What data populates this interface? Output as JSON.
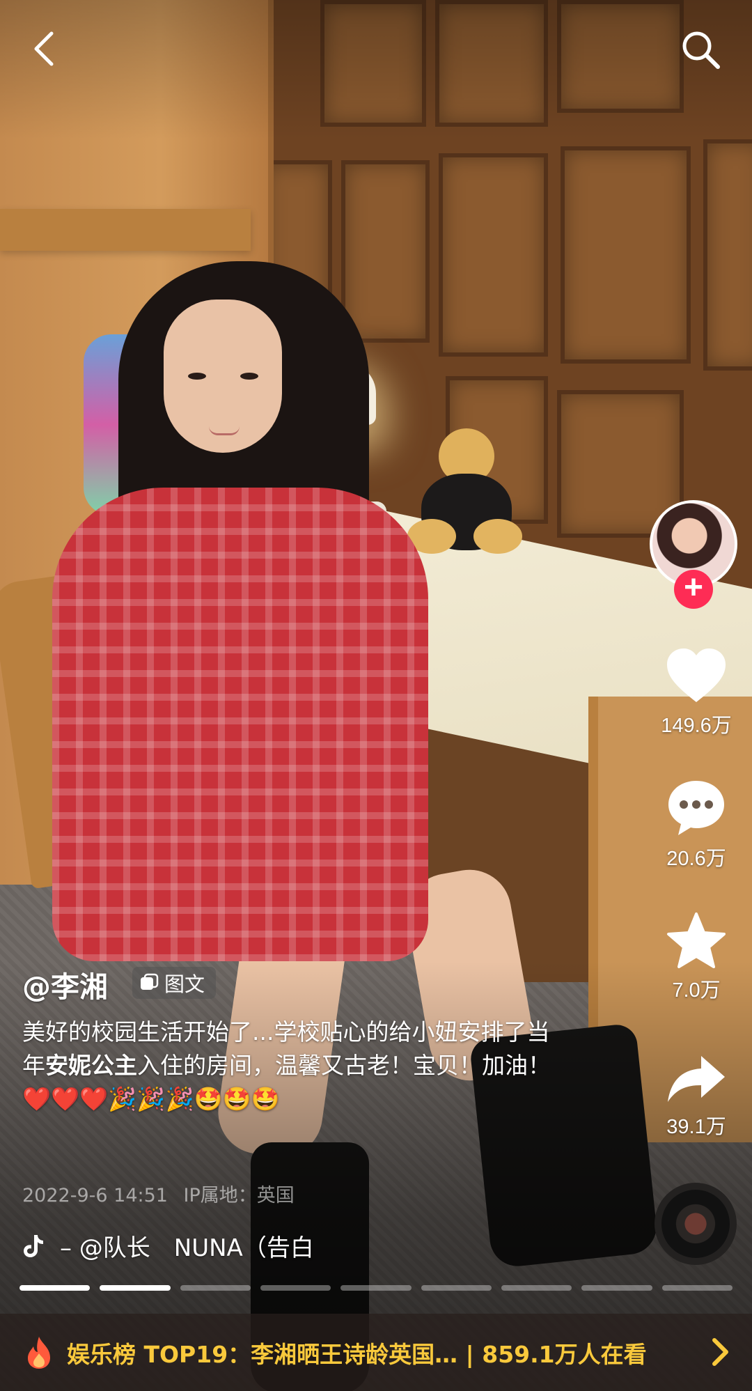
{
  "post": {
    "author": "@李湘",
    "type_tag": "图文",
    "caption_parts": [
      "美好的校园生活开始了...学校贴心的给小妞安排了当年",
      "安妮公主",
      "入住的房间，温馨又古老！宝贝！加油！❤️❤️❤️🎉🎉🎉🤩🤩🤩"
    ],
    "date": "2022-9-6 14:51",
    "ip_location": "IP属地：英国",
    "music": "– @队长　NUNA（告白"
  },
  "actions": {
    "like_count": "149.6万",
    "comment_count": "20.6万",
    "favorite_count": "7.0万",
    "share_count": "39.1万"
  },
  "progress": {
    "total_pages": 9,
    "current_page": 2
  },
  "hot_banner": {
    "rank_label": "娱乐榜 TOP19：李湘晒王诗龄英国…",
    "separator": "|",
    "viewers": "859.1万人在看"
  },
  "colors": {
    "accent": "#fe2c55",
    "hot": "#f9c93c"
  },
  "icons": [
    "back-arrow-icon",
    "search-icon",
    "heart-icon",
    "comment-icon",
    "star-icon",
    "share-icon",
    "tiktok-note-icon",
    "fire-icon",
    "chevron-right-icon",
    "gallery-icon"
  ]
}
